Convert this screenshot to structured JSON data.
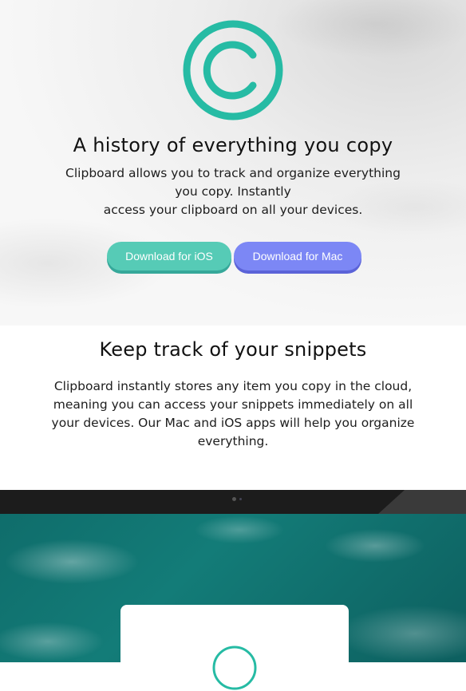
{
  "hero": {
    "title": "A history of everything you copy",
    "description_line1": "Clipboard allows you to track and organize everything",
    "description_line2": "you copy. Instantly",
    "description_line3": "access your clipboard on all your devices.",
    "buttons": {
      "ios_label": "Download for iOS",
      "mac_label": "Download for Mac"
    }
  },
  "snippets": {
    "title": "Keep track of your snippets",
    "description_line1": "Clipboard instantly stores any item you copy in the cloud,",
    "description_line2": "meaning you can access your snippets immediately on all",
    "description_line3": "your devices. Our Mac and iOS apps will help you organize",
    "description_line4": "everything."
  },
  "colors": {
    "accent_teal": "#26bba4",
    "ios_button": "#56cbb6",
    "mac_button": "#7c87f5",
    "text": "#111111"
  },
  "icons": {
    "logo": "copyright-c-logo-icon",
    "camera": "laptop-camera-icon"
  }
}
